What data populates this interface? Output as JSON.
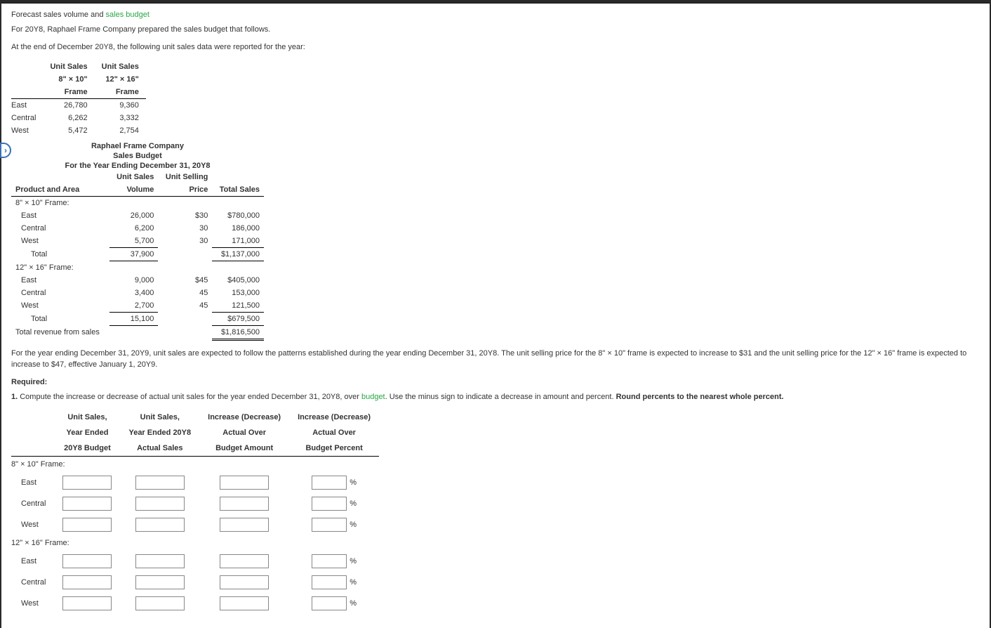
{
  "header": {
    "title_prefix": "Forecast sales volume and ",
    "title_green": "sales budget"
  },
  "intro": {
    "p1": "For 20Y8, Raphael Frame Company prepared the sales budget that follows.",
    "p2": "At the end of December 20Y8, the following unit sales data were reported for the year:"
  },
  "unit_sales_table": {
    "col1_l1": "Unit Sales",
    "col1_l2": "8\" × 10\"",
    "col1_l3": "Frame",
    "col2_l1": "Unit Sales",
    "col2_l2": "12\" × 16\"",
    "col2_l3": "Frame",
    "rows": [
      {
        "label": "East",
        "c1": "26,780",
        "c2": "9,360"
      },
      {
        "label": "Central",
        "c1": "6,262",
        "c2": "3,332"
      },
      {
        "label": "West",
        "c1": "5,472",
        "c2": "2,754"
      }
    ]
  },
  "budget": {
    "h1": "Raphael Frame Company",
    "h2": "Sales Budget",
    "h3": "For the Year Ending December 31, 20Y8",
    "cols": {
      "c0": "Product and Area",
      "c1a": "Unit Sales",
      "c1b": "Volume",
      "c2a": "Unit Selling",
      "c2b": "Price",
      "c3": "Total Sales"
    },
    "sec1_label": "8\" × 10\" Frame:",
    "sec1": [
      {
        "label": "East",
        "vol": "26,000",
        "price": "$30",
        "total": "$780,000"
      },
      {
        "label": "Central",
        "vol": "6,200",
        "price": "30",
        "total": "186,000"
      },
      {
        "label": "West",
        "vol": "5,700",
        "price": "30",
        "total": "171,000"
      }
    ],
    "sec1_total": {
      "label": "Total",
      "vol": "37,900",
      "total": "$1,137,000"
    },
    "sec2_label": "12\" × 16\" Frame:",
    "sec2": [
      {
        "label": "East",
        "vol": "9,000",
        "price": "$45",
        "total": "$405,000"
      },
      {
        "label": "Central",
        "vol": "3,400",
        "price": "45",
        "total": "153,000"
      },
      {
        "label": "West",
        "vol": "2,700",
        "price": "45",
        "total": "121,500"
      }
    ],
    "sec2_total": {
      "label": "Total",
      "vol": "15,100",
      "total": "$679,500"
    },
    "grand": {
      "label": "Total revenue from sales",
      "total": "$1,816,500"
    }
  },
  "narrative": "For the year ending December 31, 20Y9, unit sales are expected to follow the patterns established during the year ending December 31, 20Y8. The unit selling price for the 8\" × 10\" frame is expected to increase to $31 and the unit selling price for the 12\" × 16\" frame is expected to increase to $47, effective January 1, 20Y9.",
  "required_label": "Required:",
  "req1": {
    "num": "1. ",
    "t1": "Compute the increase or decrease of actual unit sales for the year ended December 31, 20Y8, over ",
    "green": "budget",
    "t2": ". Use the minus sign to indicate a decrease in amount and percent. ",
    "bold": "Round percents to the nearest whole percent."
  },
  "answer_table": {
    "cols": {
      "c1_l1": "Unit Sales,",
      "c1_l2": "Year Ended",
      "c1_l3": "20Y8 Budget",
      "c2_l1": "Unit Sales,",
      "c2_l2": "Year Ended 20Y8",
      "c2_l3": "Actual Sales",
      "c3_l1": "Increase (Decrease)",
      "c3_l2": "Actual Over",
      "c3_l3": "Budget Amount",
      "c4_l1": "Increase (Decrease)",
      "c4_l2": "Actual Over",
      "c4_l3": "Budget Percent"
    },
    "sec1_label": "8\" × 10\" Frame:",
    "sec1_rows": [
      "East",
      "Central",
      "West"
    ],
    "sec2_label": "12\" × 16\" Frame:",
    "sec2_rows": [
      "East",
      "Central",
      "West"
    ],
    "pct": "%"
  }
}
